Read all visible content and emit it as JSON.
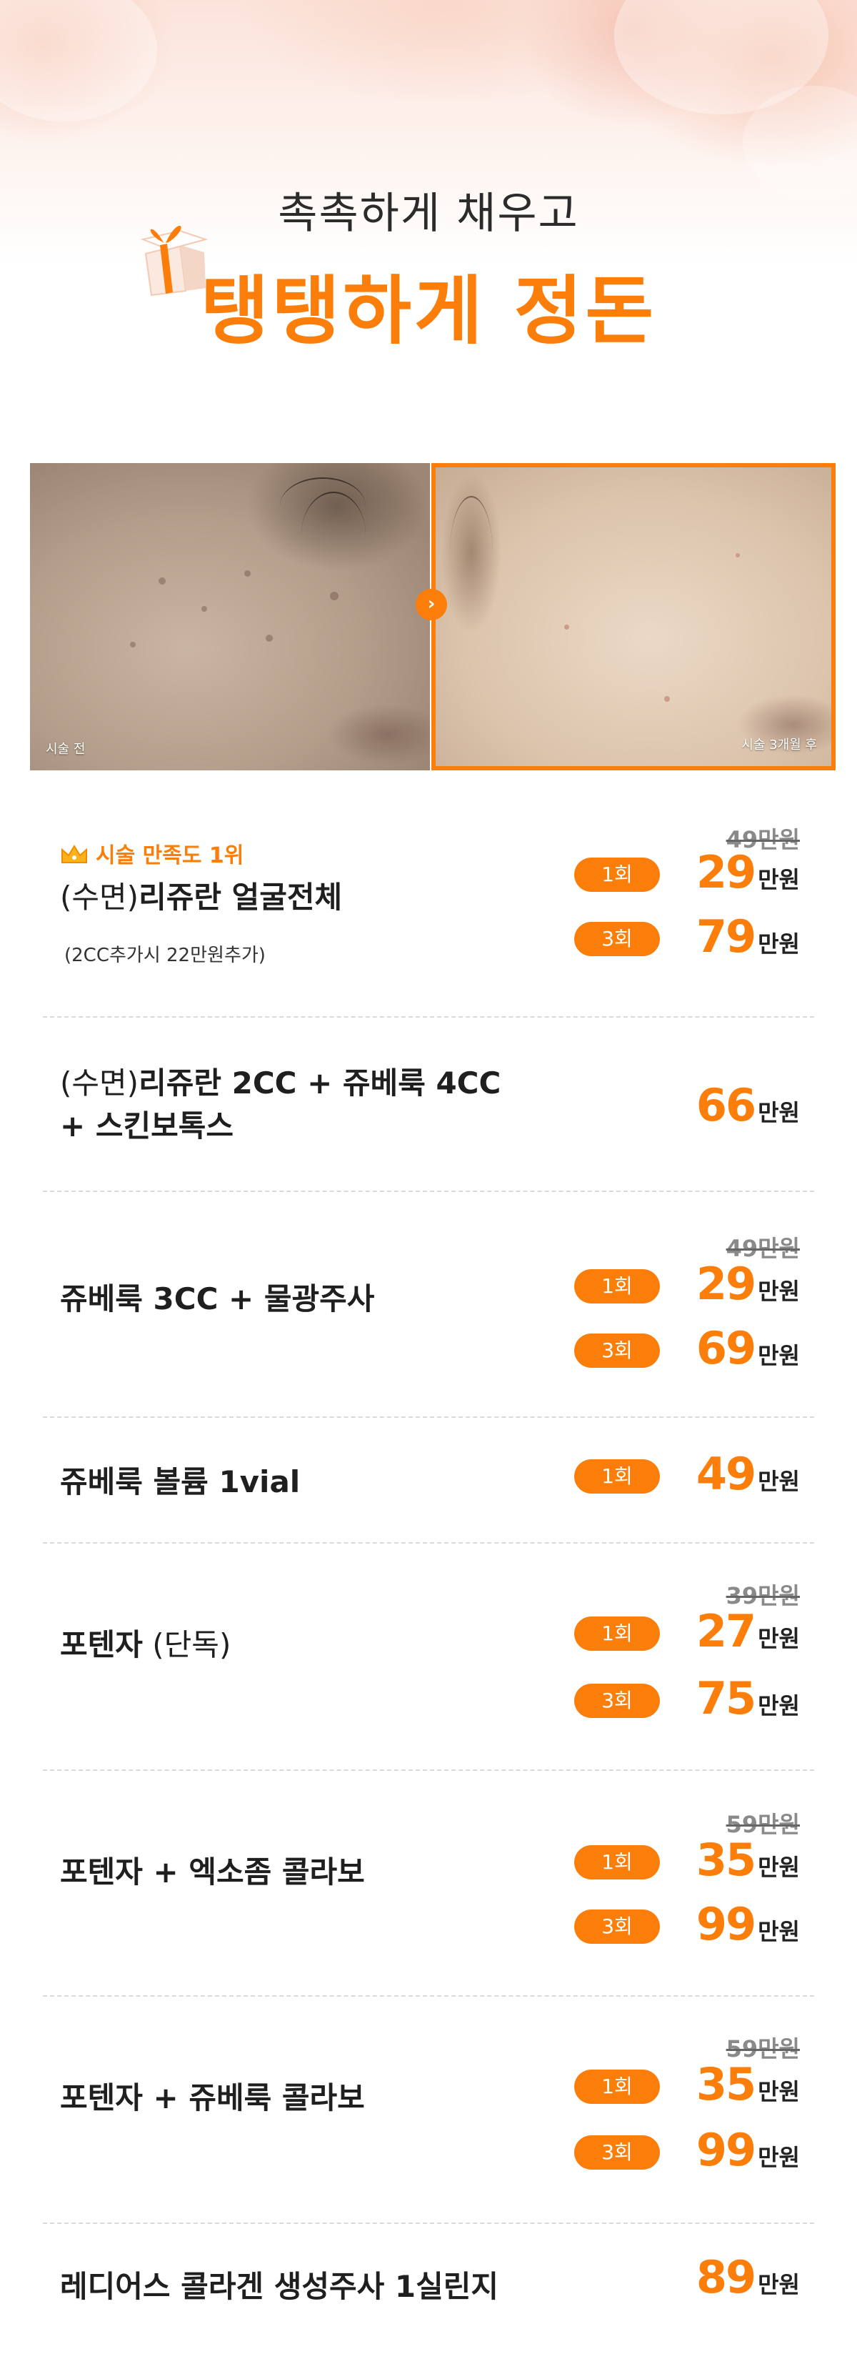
{
  "hero": {
    "subtitle": "촉촉하게 채우고",
    "title": "탱탱하게 정돈"
  },
  "compare": {
    "before_label": "시술 전",
    "after_label": "시술 3개월 후"
  },
  "colors": {
    "accent": "#fb7d0a",
    "text": "#1f1f1f",
    "muted": "#8a8a8a"
  },
  "unit": "만원",
  "items": [
    {
      "badge": "시술 만족도 1위",
      "title_paren": "(수면)",
      "title": "리쥬란 얼굴전체",
      "note": "(2CC추가시 22만원추가)",
      "original": "49만원",
      "prices": [
        {
          "count": "1회",
          "value": "29"
        },
        {
          "count": "3회",
          "value": "79"
        }
      ]
    },
    {
      "title_paren": "(수면)",
      "title": "리쥬란 2CC + 쥬베룩 4CC",
      "title_line2": "+ 스킨보톡스",
      "prices": [
        {
          "value": "66"
        }
      ]
    },
    {
      "title": "쥬베룩 3CC + 물광주사",
      "original": "49만원",
      "prices": [
        {
          "count": "1회",
          "value": "29"
        },
        {
          "count": "3회",
          "value": "69"
        }
      ]
    },
    {
      "title": "쥬베룩 볼륨 1vial",
      "prices": [
        {
          "count": "1회",
          "value": "49"
        }
      ]
    },
    {
      "title": "포텐자",
      "title_suffix": " (단독)",
      "original": "39만원",
      "prices": [
        {
          "count": "1회",
          "value": "27"
        },
        {
          "count": "3회",
          "value": "75"
        }
      ]
    },
    {
      "title": "포텐자 + 엑소좀 콜라보",
      "original": "59만원",
      "prices": [
        {
          "count": "1회",
          "value": "35"
        },
        {
          "count": "3회",
          "value": "99"
        }
      ]
    },
    {
      "title": "포텐자 + 쥬베룩 콜라보",
      "original": "59만원",
      "prices": [
        {
          "count": "1회",
          "value": "35"
        },
        {
          "count": "3회",
          "value": "99"
        }
      ]
    },
    {
      "title": "레디어스 콜라겐 생성주사 1실린지",
      "prices": [
        {
          "value": "89"
        }
      ]
    }
  ]
}
